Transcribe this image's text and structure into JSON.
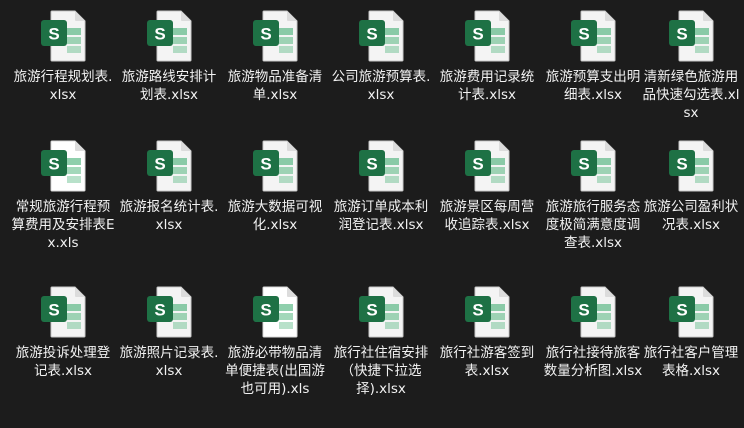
{
  "icon_letter": "S",
  "colors": {
    "background": "#1c1c1c",
    "icon_green": "#1e7145",
    "icon_green_light": "#33a867",
    "page": "#f4f4f4",
    "label": "#f2f2f2"
  },
  "files": [
    {
      "name": "旅游行程规划表.xlsx",
      "icon": "xlsx-icon"
    },
    {
      "name": "旅游路线安排计划表.xlsx",
      "icon": "xlsx-icon"
    },
    {
      "name": "旅游物品准备清单.xlsx",
      "icon": "xlsx-icon"
    },
    {
      "name": "公司旅游预算表.xlsx",
      "icon": "xlsx-icon"
    },
    {
      "name": "旅游费用记录统计表.xlsx",
      "icon": "xlsx-icon"
    },
    {
      "name": "旅游预算支出明细表.xlsx",
      "icon": "xlsx-icon"
    },
    {
      "name": "清新绿色旅游用品快速勾选表.xlsx",
      "icon": "xlsx-icon"
    },
    {
      "name": "常规旅游行程预算费用及安排表Ex.xls",
      "icon": "xls-icon"
    },
    {
      "name": "旅游报名统计表.xlsx",
      "icon": "xlsx-icon"
    },
    {
      "name": "旅游大数据可视化.xlsx",
      "icon": "xlsx-icon"
    },
    {
      "name": "旅游订单成本利润登记表.xlsx",
      "icon": "xlsx-icon"
    },
    {
      "name": "旅游景区每周营收追踪表.xlsx",
      "icon": "xlsx-icon"
    },
    {
      "name": "旅游旅行服务态度极简满意度调查表.xlsx",
      "icon": "xlsx-icon"
    },
    {
      "name": "旅游公司盈利状况表.xlsx",
      "icon": "xlsx-icon"
    },
    {
      "name": "旅游投诉处理登记表.xlsx",
      "icon": "xlsx-icon"
    },
    {
      "name": "旅游照片记录表.xlsx",
      "icon": "xlsx-icon"
    },
    {
      "name": "旅游必带物品清单便捷表(出国游也可用).xls",
      "icon": "xls-icon"
    },
    {
      "name": "旅行社住宿安排（快捷下拉选择).xlsx",
      "icon": "xlsx-icon"
    },
    {
      "name": "旅行社游客签到表.xlsx",
      "icon": "xlsx-icon"
    },
    {
      "name": "旅行社接待旅客数量分析图.xlsx",
      "icon": "xlsx-icon"
    },
    {
      "name": "旅行社客户管理表格.xlsx",
      "icon": "xlsx-icon"
    }
  ]
}
